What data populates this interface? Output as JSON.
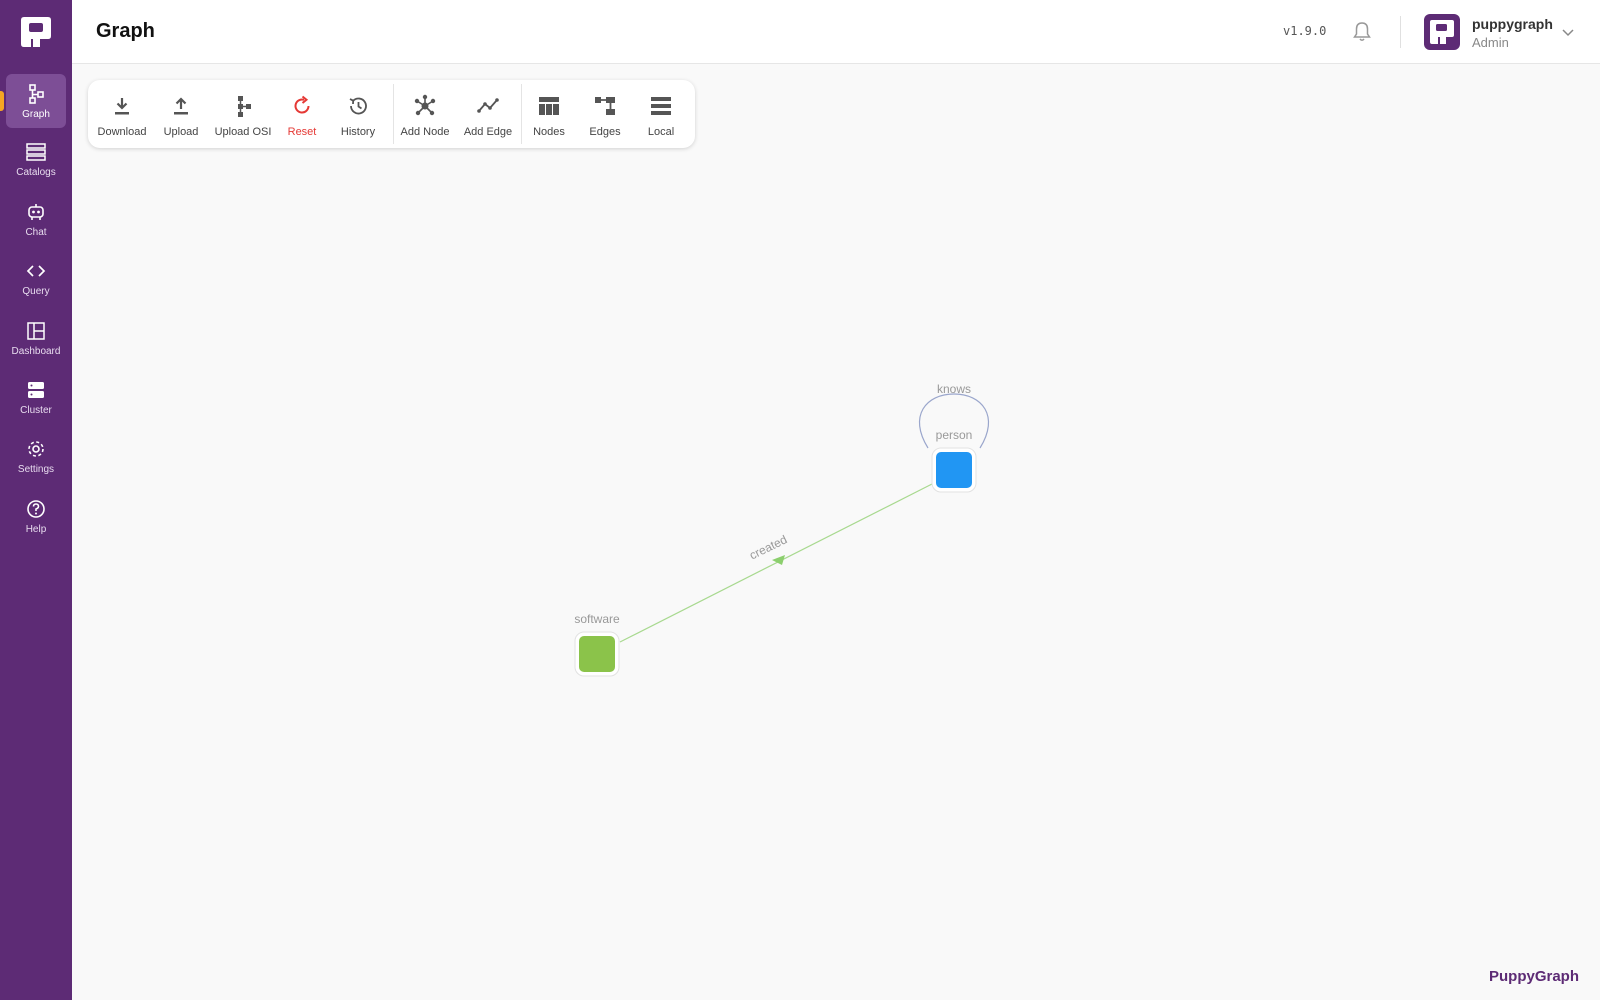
{
  "app": {
    "brand_footer": "PuppyGraph"
  },
  "sidebar": {
    "items": [
      {
        "id": "graph",
        "label": "Graph",
        "icon": "graph-icon",
        "active": true
      },
      {
        "id": "catalogs",
        "label": "Catalogs",
        "icon": "catalogs-icon"
      },
      {
        "id": "chat",
        "label": "Chat",
        "icon": "robot-icon"
      },
      {
        "id": "query",
        "label": "Query",
        "icon": "code-icon"
      },
      {
        "id": "dashboard",
        "label": "Dashboard",
        "icon": "dashboard-icon"
      },
      {
        "id": "cluster",
        "label": "Cluster",
        "icon": "server-icon"
      },
      {
        "id": "settings",
        "label": "Settings",
        "icon": "gear-icon"
      },
      {
        "id": "help",
        "label": "Help",
        "icon": "help-icon"
      }
    ]
  },
  "header": {
    "title": "Graph",
    "version": "v1.9.0",
    "user": {
      "name": "puppygraph",
      "role": "Admin"
    }
  },
  "toolbar": {
    "buttons": [
      {
        "id": "download",
        "label": "Download",
        "icon": "download-icon"
      },
      {
        "id": "upload",
        "label": "Upload",
        "icon": "upload-icon"
      },
      {
        "id": "upload-osi",
        "label": "Upload OSI",
        "icon": "schema-icon"
      },
      {
        "id": "reset",
        "label": "Reset",
        "icon": "reset-icon"
      },
      {
        "id": "history",
        "label": "History",
        "icon": "history-icon"
      },
      {
        "id": "add-node",
        "label": "Add Node",
        "icon": "add-node-icon"
      },
      {
        "id": "add-edge",
        "label": "Add Edge",
        "icon": "add-edge-icon"
      },
      {
        "id": "nodes",
        "label": "Nodes",
        "icon": "table-icon"
      },
      {
        "id": "edges",
        "label": "Edges",
        "icon": "edges-icon"
      },
      {
        "id": "local",
        "label": "Local",
        "icon": "list-icon"
      }
    ]
  },
  "graph": {
    "nodes": [
      {
        "id": "person",
        "label": "person",
        "color": "#2196f3"
      },
      {
        "id": "software",
        "label": "software",
        "color": "#8bc34a"
      }
    ],
    "edges": [
      {
        "id": "knows",
        "label": "knows",
        "from": "person",
        "to": "person",
        "color": "#9aa6cc"
      },
      {
        "id": "created",
        "label": "created",
        "from": "person",
        "to": "software",
        "color": "#a8d98f"
      }
    ]
  },
  "colors": {
    "sidebar_bg": "#5d2b75",
    "sidebar_active": "#7d4e96",
    "accent": "#f5a623",
    "reset": "#e53935"
  }
}
